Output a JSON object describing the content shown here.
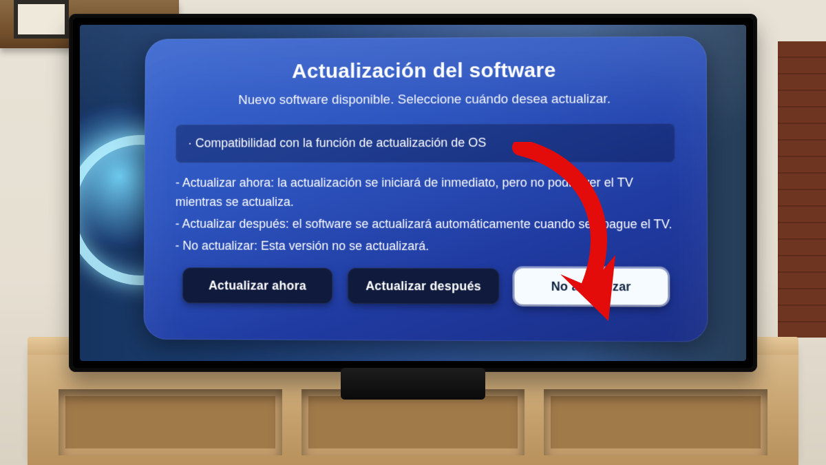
{
  "dialog": {
    "title": "Actualización del software",
    "subtitle": "Nuevo software disponible. Seleccione cuándo desea actualizar.",
    "feature_line": "· Compatibilidad con la función de actualización de OS",
    "line_now": "- Actualizar ahora: la actualización se iniciará de inmediato, pero no podrá ver el TV mientras se actualiza.",
    "line_later": "- Actualizar después: el software se actualizará automáticamente cuando se apague el TV.",
    "line_never": "- No actualizar: Esta versión no se actualizará.",
    "buttons": {
      "now": "Actualizar ahora",
      "later": "Actualizar después",
      "never": "No actualizar"
    },
    "selected_button": "never"
  },
  "annotation": {
    "arrow_color": "#e40b0b",
    "points_to": "no-update-button"
  }
}
